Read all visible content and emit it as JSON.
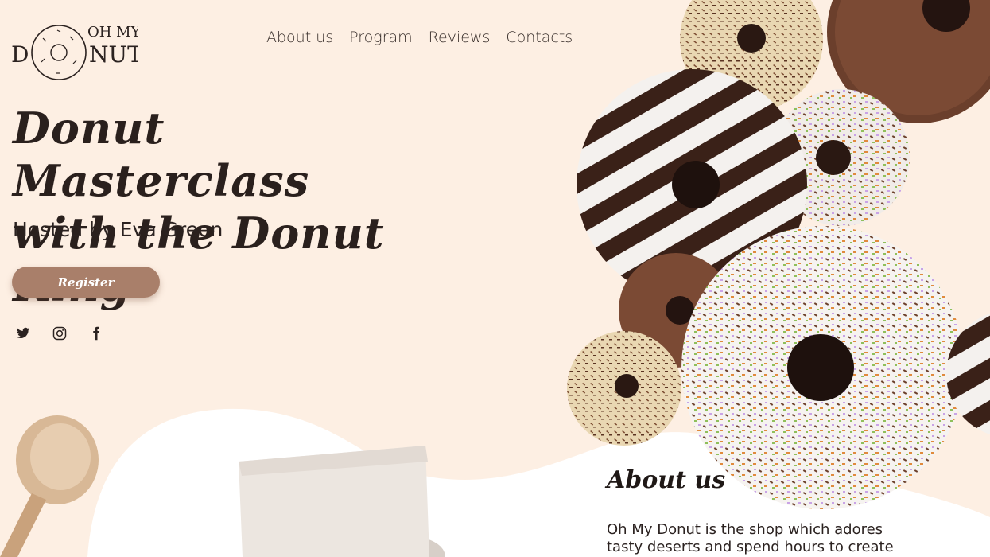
{
  "brand": {
    "logo_top": "OH MY",
    "logo_bottom": "DONUT"
  },
  "nav": {
    "items": [
      "About us",
      "Program",
      "Reviews",
      "Contacts"
    ]
  },
  "hero": {
    "title": "Donut Masterclass with the Donut King",
    "subtitle": "Hosted by Eva Green",
    "register_label": "Register"
  },
  "social": [
    "twitter-icon",
    "instagram-icon",
    "facebook-icon"
  ],
  "about": {
    "title": "About us",
    "text": "Oh My Donut is the shop which adores tasty deserts and spend hours to create"
  },
  "colors": {
    "background": "#fdefe3",
    "accent": "#a97f6a",
    "text": "#2b2220"
  }
}
